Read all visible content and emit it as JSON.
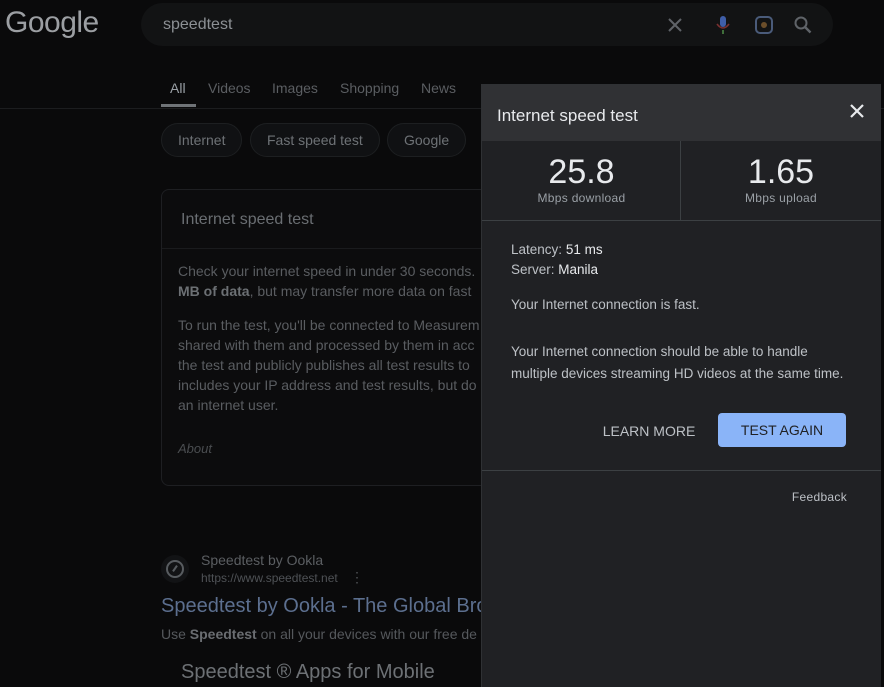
{
  "header": {
    "logo_text": "Google",
    "search_value": "speedtest",
    "icons": [
      "close-icon",
      "mic-icon",
      "lens-icon",
      "search-icon"
    ]
  },
  "tabs": [
    {
      "label": "All"
    },
    {
      "label": "Videos"
    },
    {
      "label": "Images"
    },
    {
      "label": "Shopping"
    },
    {
      "label": "News"
    }
  ],
  "chips": [
    {
      "label": "Internet"
    },
    {
      "label": "Fast speed test"
    },
    {
      "label": "Google"
    }
  ],
  "card": {
    "title": "Internet speed test",
    "p1_line1": "Check your internet speed in under 30 seconds.",
    "p1_line2_bold": "MB of data",
    "p1_line2": ", but may transfer more data on fast",
    "p2_line1": "To run the test, you'll be connected to Measurem",
    "p2_line2": "shared with them and processed by them in acc",
    "p2_line3": "the test and publicly publishes all test results to",
    "p2_line4": "includes your IP address and test results, but do",
    "p2_line5": "an internet user.",
    "about": "About"
  },
  "result": {
    "site_name": "Speedtest by Ookla",
    "site_url": "https://www.speedtest.net",
    "title": "Speedtest by Ookla - The Global Bro",
    "snippet_pre": "Use ",
    "snippet_bold": "Speedtest",
    "snippet_post": " on all your devices with our free de",
    "sub_title": "Speedtest ® Apps for Mobile"
  },
  "dialog": {
    "title": "Internet speed test",
    "download_value": "25.8",
    "download_unit": "Mbps download",
    "upload_value": "1.65",
    "upload_unit": "Mbps upload",
    "latency_label": "Latency:",
    "latency_value": "51 ms",
    "server_label": "Server:",
    "server_value": "Manila",
    "fast_text": "Your Internet connection is fast.",
    "description": "Your Internet connection should be able to handle multiple devices streaming HD videos at the same time.",
    "learn_more": "LEARN MORE",
    "test_again": "TEST AGAIN",
    "feedback": "Feedback"
  },
  "colors": {
    "accent": "#8ab4f8",
    "dialog_bg": "#202124",
    "dialog_header": "#303134"
  }
}
